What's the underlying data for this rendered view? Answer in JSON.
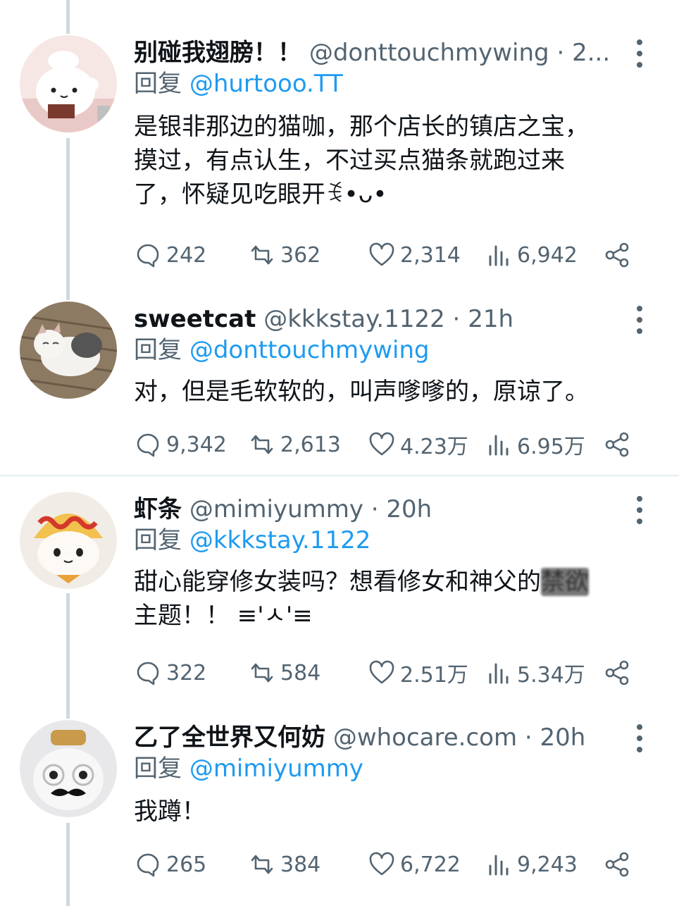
{
  "tweets": [
    {
      "name": "别碰我翅膀！！",
      "handle": "@donttouchmywing",
      "sep": " · ",
      "time": "2...",
      "reply_label": "回复 ",
      "reply_to": "@hurtooo.TT",
      "body": "是银非那边的猫咖，那个店长的镇店之宝，\n摸过，有点认生，不过买点猫条就跑过来\n了，怀疑见吃眼开ꉂ•ᴗ•",
      "comments": "242",
      "retweets": "362",
      "likes": "2,314",
      "views": "6,942",
      "avatar": "white-plush-with-book"
    },
    {
      "name": "sweetcat",
      "handle": "@kkkstay.1122",
      "sep": " · ",
      "time": "21h",
      "reply_label": "回复 ",
      "reply_to": "@donttouchmywing",
      "body": "对，但是毛软软的，叫声嗲嗲的，原谅了。",
      "comments": "9,342",
      "retweets": "2,613",
      "likes": "4.23万",
      "views": "6.95万",
      "avatar": "sleeping-cat-photo"
    },
    {
      "name": "虾条",
      "handle": "@mimiyummy",
      "sep": " · ",
      "time": "20h",
      "reply_label": "回复 ",
      "reply_to": "@kkkstay.1122",
      "body_before": "甜心能穿修女装吗？想看修女和神父的",
      "body_blurred": "禁欲",
      "body_after": "\n主题！！ ≡'ㅅ'≡",
      "comments": "322",
      "retweets": "584",
      "likes": "2.51万",
      "views": "5.34万",
      "avatar": "cat-plush-with-hat"
    },
    {
      "name": "乙了全世界又何妨",
      "handle": "@whocare.com",
      "sep": " · ",
      "time": "20h",
      "reply_label": "回复 ",
      "reply_to": "@mimiyummy",
      "body": "我蹲！",
      "comments": "265",
      "retweets": "384",
      "likes": "6,722",
      "views": "9,243",
      "avatar": "cat-with-glasses-and-mustache"
    }
  ],
  "icons": {
    "comment": "comment-icon",
    "retweet": "retweet-icon",
    "like": "heart-icon",
    "views": "views-icon",
    "share": "share-icon",
    "more": "more-vertical-icon"
  },
  "colors": {
    "link": "#1d9bf0",
    "muted": "#536471",
    "text": "#0f1419",
    "thread_line": "#cfd9de"
  }
}
